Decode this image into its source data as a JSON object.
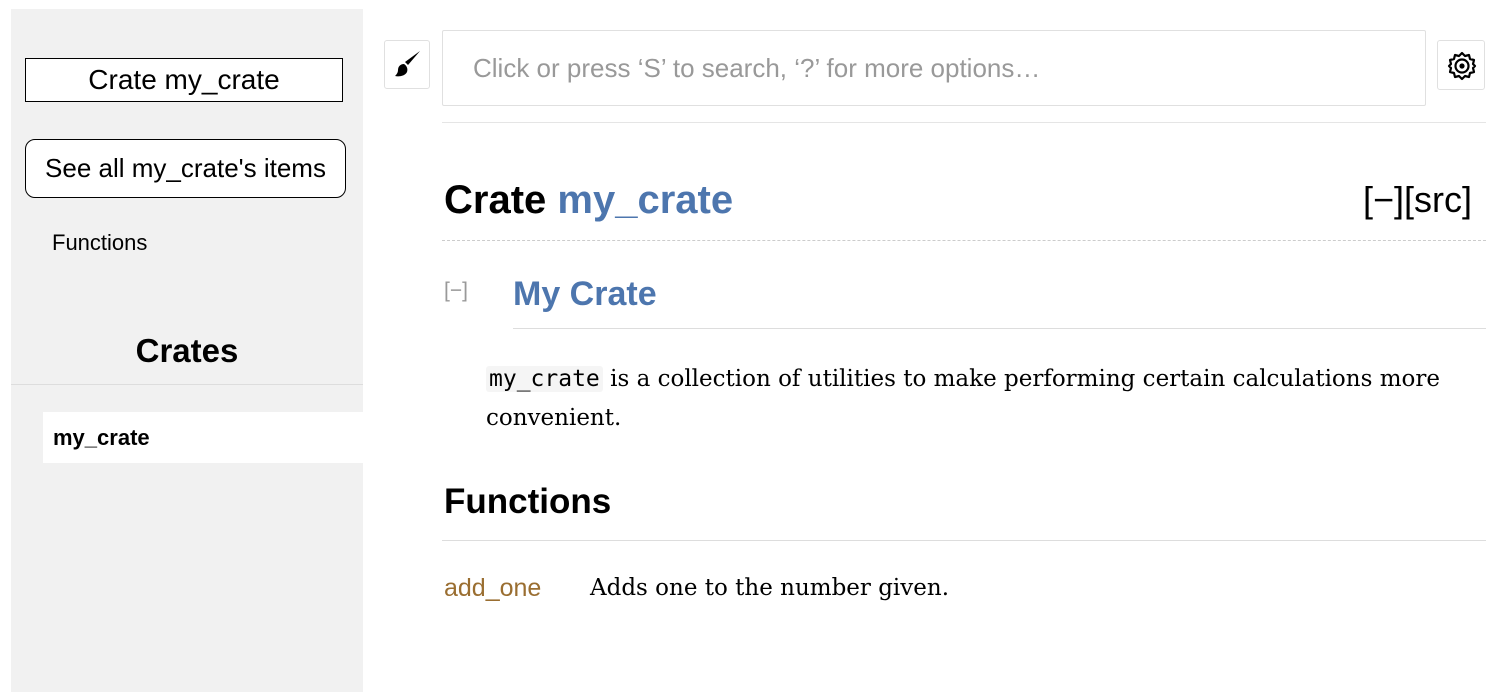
{
  "sidebar": {
    "crate_title": "Crate my_crate",
    "see_all_label": "See all my_crate's items",
    "functions_link": "Functions",
    "crates_heading": "Crates",
    "crate_items": [
      "my_crate"
    ]
  },
  "topbar": {
    "theme_icon": "paintbrush-icon",
    "search_placeholder": "Click or press ‘S’ to search, ‘?’ for more options…",
    "settings_icon": "gear-icon"
  },
  "main": {
    "title_prefix": "Crate ",
    "title_name": "my_crate",
    "collapse_all": "[−]",
    "src_link": "[src]",
    "doc_collapse": "[−]",
    "doc_heading": "My Crate",
    "doc_code": "my_crate",
    "doc_text": " is a collection of utilities to make performing certain calculations more convenient.",
    "functions_heading": "Functions",
    "functions": [
      {
        "name": "add_one",
        "description": "Adds one to the number given."
      }
    ]
  },
  "colors": {
    "link_blue": "#4d76ae",
    "function_brown": "#9a6e31",
    "sidebar_bg": "#f1f1f1"
  }
}
